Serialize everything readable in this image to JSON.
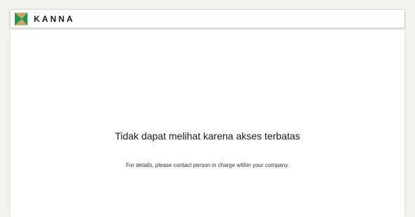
{
  "header": {
    "brand_name": "KANNA",
    "logo_icon": "kanna-logo-icon",
    "brand_colors": {
      "green": "#1a9a4a",
      "gold": "#c9a46a"
    }
  },
  "main": {
    "message": "Tidak dapat melihat karena akses terbatas",
    "details": "For details, please contact person in charge within your company."
  }
}
